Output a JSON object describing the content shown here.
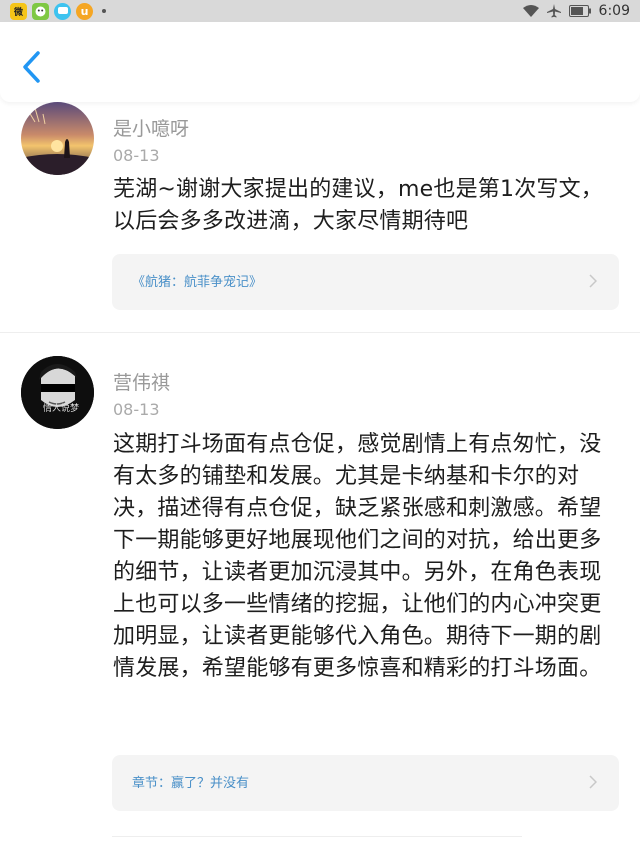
{
  "status_bar": {
    "app_icons": [
      {
        "name": "weibo-app-icon",
        "text": "微",
        "bg": "#f5c518"
      },
      {
        "name": "cartoon-app-icon",
        "text": "",
        "bg": "#7fc843"
      },
      {
        "name": "chat-app-icon",
        "text": "",
        "bg": "#3ec3ef"
      },
      {
        "name": "u-app-icon",
        "text": "u",
        "bg": "#f5a623"
      }
    ],
    "time": "6:09"
  },
  "comments": [
    {
      "username": "是小噫呀",
      "date": "08-13",
      "text": "芜湖~谢谢大家提出的建议，me也是第1次写文，以后会多多改进滴，大家尽情期待吧",
      "link_label": "《航猪：航菲争宠记》"
    },
    {
      "username": "营伟祺",
      "date": "08-13",
      "avatar_caption": "情人说梦",
      "text": "这期打斗场面有点仓促，感觉剧情上有点匆忙，没有太多的铺垫和发展。尤其是卡纳基和卡尔的对决，描述得有点仓促，缺乏紧张感和刺激感。希望下一期能够更好地展现他们之间的对抗，给出更多的细节，让读者更加沉浸其中。另外，在角色表现上也可以多一些情绪的挖掘，让他们的内心冲突更加明显，让读者更能够代入角色。期待下一期的剧情发展，希望能够有更多惊喜和精彩的打斗场面。",
      "link_label": "章节：赢了？并没有"
    }
  ],
  "colors": {
    "accent": "#2196f3",
    "link": "#4a90c8",
    "meta_text": "#999999"
  }
}
